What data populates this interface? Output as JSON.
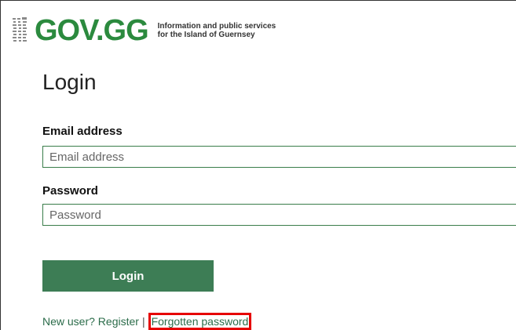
{
  "header": {
    "logo_text": "GOV.GG",
    "tagline_line1": "Information and public services",
    "tagline_line2": "for the Island of Guernsey",
    "brand_color": "#2b8a3e",
    "crest_icon": "guernsey-crest-icon"
  },
  "page": {
    "title": "Login"
  },
  "form": {
    "email_label": "Email address",
    "email_placeholder": "Email address",
    "email_value": "",
    "password_label": "Password",
    "password_placeholder": "Password",
    "password_value": "",
    "submit_label": "Login",
    "button_color": "#3d7d55"
  },
  "footer_links": {
    "register_label": "New user? Register",
    "separator": "|",
    "forgot_label": "Forgotten password",
    "highlight_color": "#e60000"
  }
}
